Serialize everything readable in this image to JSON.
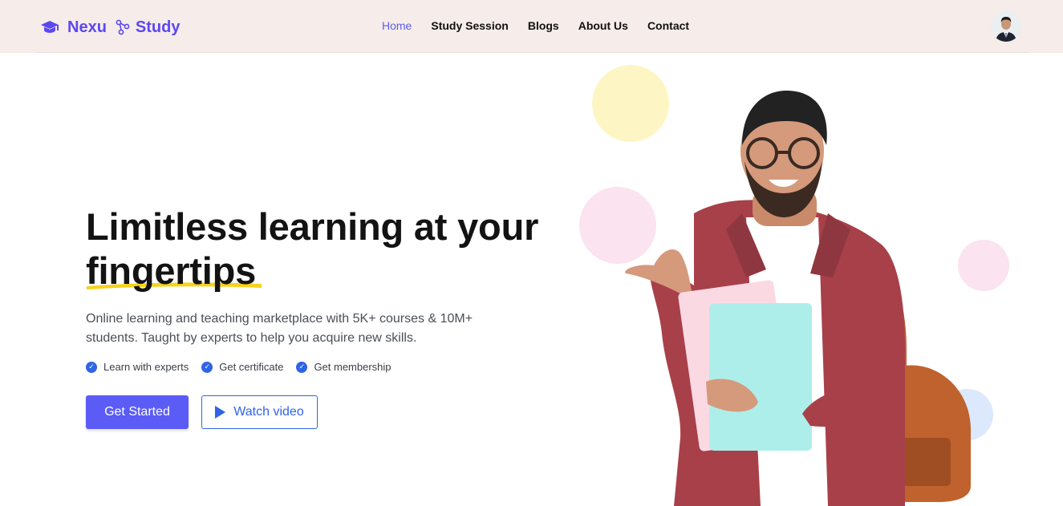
{
  "brand": {
    "part1": "Nexu",
    "part2": "Study"
  },
  "nav": [
    {
      "label": "Home"
    },
    {
      "label": "Study Session"
    },
    {
      "label": "Blogs"
    },
    {
      "label": "About Us"
    },
    {
      "label": "Contact"
    }
  ],
  "hero": {
    "headline_line1": "Limitless learning at your",
    "headline_line2": "fingertips",
    "subtext": "Online learning and teaching marketplace with 5K+ courses & 10M+ students. Taught by experts to help you acquire new skills.",
    "features": [
      {
        "label": "Learn with experts"
      },
      {
        "label": "Get certificate"
      },
      {
        "label": "Get membership"
      }
    ],
    "primary_button": "Get Started",
    "secondary_button": "Watch video"
  },
  "colors": {
    "accent": "#5b5cf6",
    "brand": "#5b48f2",
    "link_blue": "#2f64e6",
    "navbar_bg": "#f6ece9",
    "highlight": "#f7d21a",
    "circle_yellow": "#fdf6c4",
    "circle_pink": "#fbe3ef",
    "circle_blue": "#dce8fb"
  },
  "icons": {
    "brand": "graduation-cap-icon",
    "brand_separator": "branch-icon",
    "feature": "check-circle-icon",
    "video": "play-icon"
  }
}
